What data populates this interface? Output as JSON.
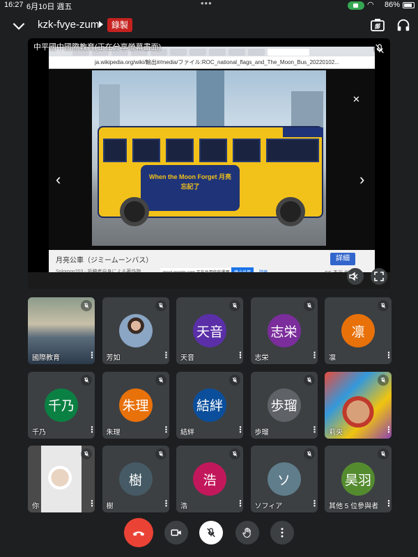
{
  "status_bar": {
    "time": "16:27",
    "date": "6月10日 週五",
    "battery": "86%"
  },
  "top_bar": {
    "meeting_code": "kzk-fvye-zum",
    "recording_badge": "錄製"
  },
  "presentation": {
    "label": "中平國中國際教育(正在分享螢幕畫面)",
    "browser_url": "ja.wikipedia.org/wiki/輸出#/media/ファイル:ROC_national_flags_and_The_Moon_Bus_20220102...",
    "bus_caption": "When the Moon Forget 月亮忘記了",
    "image_title": "月亮公車（ジミームーンバス）",
    "image_credit": "Solomon203 - 投稿者自身による著作物",
    "detail_button": "詳細",
    "share_notice": "meet.google.com 正在共用你的畫面。",
    "stop_share": "停止共用",
    "hide": "隱藏",
    "license": "CC 表示-継承 4.0"
  },
  "participants": [
    {
      "name": "國際教育",
      "type": "video"
    },
    {
      "name": "芳如",
      "type": "photo"
    },
    {
      "name": "天音",
      "initials": "天音",
      "color": "#5b2fa8"
    },
    {
      "name": "志栄",
      "initials": "志栄",
      "color": "#7b2d9c"
    },
    {
      "name": "凛",
      "initials": "凛",
      "color": "#e8710a"
    },
    {
      "name": "千乃",
      "initials": "千乃",
      "color": "#0b8043"
    },
    {
      "name": "朱理",
      "initials": "朱理",
      "color": "#e8710a"
    },
    {
      "name": "結絆",
      "initials": "結絆",
      "color": "#0b4f9c"
    },
    {
      "name": "歩瑠",
      "initials": "歩瑠",
      "color": "#5f6368"
    },
    {
      "name": "莉央",
      "type": "video"
    },
    {
      "name": "你",
      "type": "video"
    },
    {
      "name": "樹",
      "initials": "樹",
      "color": "#455a64"
    },
    {
      "name": "浩",
      "initials": "浩",
      "color": "#c2185b"
    },
    {
      "name": "ソフィア",
      "initials": "ソ",
      "color": "#607d8b"
    },
    {
      "name": "其他 5 位參與者",
      "initials": "昊羽",
      "color": "#558b2f"
    }
  ],
  "colors": {
    "end_call": "#ea4335",
    "tile": "#3c4043",
    "background": "#1e1f21",
    "record": "#c5221f"
  }
}
